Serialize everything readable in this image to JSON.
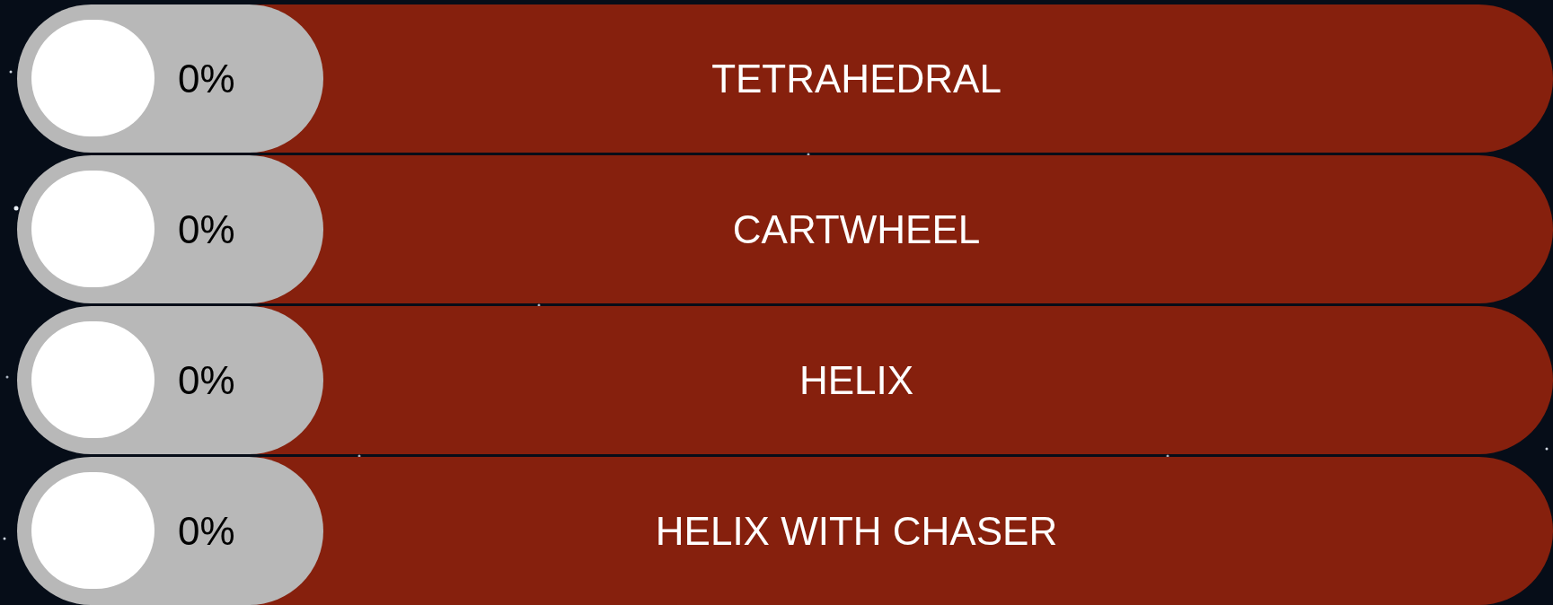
{
  "patterns": [
    {
      "label": "TETRAHEDRAL",
      "reading": "0%"
    },
    {
      "label": "CARTWHEEL",
      "reading": "0%"
    },
    {
      "label": "HELIX",
      "reading": "0%"
    },
    {
      "label": "HELIX WITH CHASER",
      "reading": "0%"
    }
  ]
}
